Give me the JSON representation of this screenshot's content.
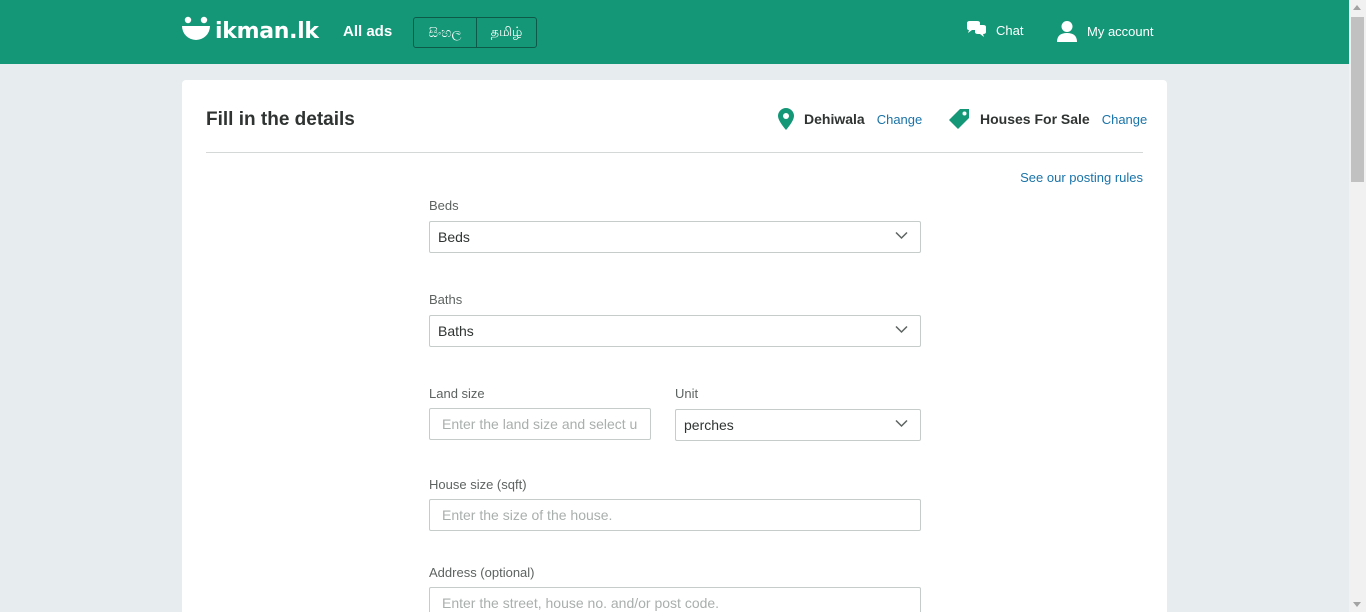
{
  "header": {
    "logo_text": "ikman.lk",
    "all_ads": "All ads",
    "languages": [
      "සිංහල",
      "தமிழ்"
    ],
    "chat": "Chat",
    "account": "My account",
    "brand_color": "#149777"
  },
  "form": {
    "title": "Fill in the details",
    "location": {
      "label": "Dehiwala",
      "change": "Change",
      "icon": "location-pin-icon"
    },
    "category": {
      "label": "Houses For Sale",
      "change": "Change",
      "icon": "tag-icon"
    },
    "rules_link": "See our posting rules",
    "beds": {
      "label": "Beds",
      "value": "Beds"
    },
    "baths": {
      "label": "Baths",
      "value": "Baths"
    },
    "land_size": {
      "label": "Land size",
      "placeholder": "Enter the land size and select unit"
    },
    "unit": {
      "label": "Unit",
      "value": "perches"
    },
    "house_size": {
      "label": "House size (sqft)",
      "placeholder": "Enter the size of the house."
    },
    "address": {
      "label": "Address (optional)",
      "placeholder": "Enter the street, house no. and/or post code."
    }
  },
  "colors": {
    "accent": "#149777",
    "link": "#1a73a8"
  }
}
